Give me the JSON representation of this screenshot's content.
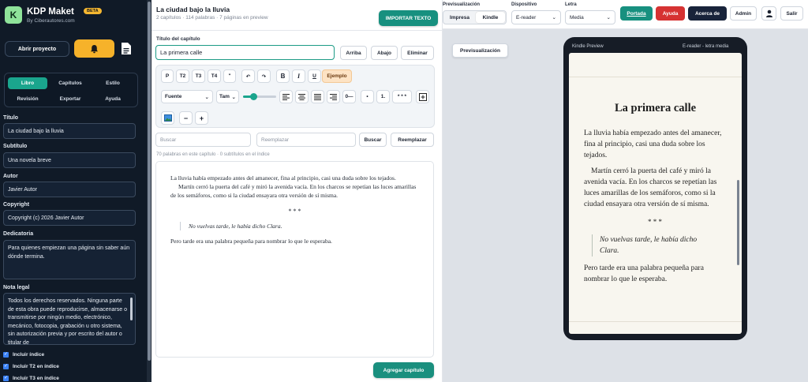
{
  "app": {
    "title": "KDP Maket",
    "badge": "BETA",
    "byline": "By Ciberautores.com",
    "logo_letter": "K"
  },
  "sidebar": {
    "open_project": "Abrir proyecto",
    "nav": [
      "Libro",
      "Capítulos",
      "Estilo",
      "Revisión",
      "Exportar",
      "Ayuda"
    ],
    "fields": {
      "titulo_label": "Título",
      "titulo_value": "La ciudad bajo la lluvia",
      "subtitulo_label": "Subtítulo",
      "subtitulo_value": "Una novela breve",
      "autor_label": "Autor",
      "autor_value": "Javier Autor",
      "copyright_label": "Copyright",
      "copyright_value": "Copyright (c) 2026 Javier Autor",
      "dedicatoria_label": "Dedicatoria",
      "dedicatoria_value": "Para quienes empiezan una página sin saber aún dónde termina.",
      "nota_label": "Nota legal",
      "nota_value": "Todos los derechos reservados. Ninguna parte de esta obra puede reproducirse, almacenarse o transmitirse por ningún medio, electrónico, mecánico, fotocopia, grabación u otro sistema, sin autorización previa y por escrito del autor o titular de"
    },
    "checks": [
      "Incluir índice",
      "Incluir T2 en índice",
      "Incluir T3 en índice"
    ]
  },
  "editor": {
    "doc_title": "La ciudad bajo la lluvia",
    "doc_sub": "2 capítulos · 114 palabras · 7 páginas en preview",
    "import_label": "IMPORTAR TEXTO",
    "chapter_label": "Título del capítulo",
    "chapter_value": "La primera calle",
    "arriba": "Arriba",
    "abajo": "Abajo",
    "eliminar": "Eliminar",
    "tb": {
      "p": "P",
      "t2": "T2",
      "t3": "T3",
      "t4": "T4",
      "quote": "\"",
      "undo": "↶",
      "redo": "↷",
      "bold": "B",
      "italic": "I",
      "underline": "U",
      "ejemplo": "Ejemplo",
      "fuente": "Fuente",
      "tam": "Tam",
      "hr": "0—",
      "bullet": "•",
      "numbered": "1.",
      "dots": "* * *",
      "minus": "−",
      "plus": "+"
    },
    "search_placeholder": "Buscar",
    "replace_placeholder": "Reemplazar",
    "buscar": "Buscar",
    "reemplazar": "Reemplazar",
    "stats": "70 palabras en este capítulo · 0 subtítulos en el índice",
    "body": {
      "p1": "La lluvia había empezado antes del amanecer, fina al principio, casi una duda sobre los tejados.",
      "p2": "Martín cerró la puerta del café y miró la avenida vacía. En los charcos se repetían las luces amarillas de los semáforos, como si la ciudad ensayara otra versión de sí misma.",
      "sep": "* * *",
      "quote": "No vuelvas tarde, le había dicho Clara.",
      "p3": "Pero tarde era una palabra pequeña para nombrar lo que le esperaba."
    },
    "add_chapter": "Agregar capítulo"
  },
  "topbar": {
    "preview_label": "Previsualización",
    "impresa": "Impresa",
    "kindle": "Kindle",
    "device_label": "Dispositivo",
    "device_value": "E-reader",
    "letter_label": "Letra",
    "letter_value": "Media",
    "portada": "Portada",
    "ayuda": "Ayuda",
    "acerca": "Acerca de",
    "admin": "Admin",
    "salir": "Salir"
  },
  "preview": {
    "button": "Previsualización",
    "header_left": "Kindle Preview",
    "header_right": "E-reader - letra media",
    "chapter_title": "La primera calle"
  },
  "colors": {
    "accent": "#1aa58d",
    "sidebar_bg": "#101a27",
    "portada": "#17907f",
    "ayuda": "#d63232",
    "acerca": "#18233a"
  }
}
